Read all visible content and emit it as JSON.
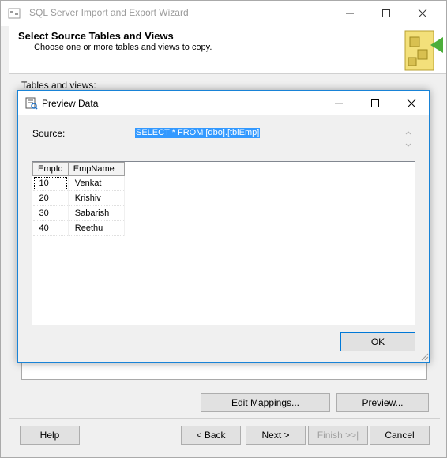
{
  "wizard": {
    "title": "SQL Server Import and Export Wizard",
    "header_title": "Select Source Tables and Views",
    "header_subtitle": "Choose one or more tables and views to copy.",
    "tables_label": "Tables and views:",
    "buttons": {
      "edit_mappings": "Edit Mappings...",
      "preview": "Preview...",
      "help": "Help",
      "back": "< Back",
      "next": "Next >",
      "finish": "Finish >>|",
      "cancel": "Cancel"
    }
  },
  "dialog": {
    "title": "Preview Data",
    "source_label": "Source:",
    "source_query": "SELECT * FROM [dbo].[tblEmp]",
    "columns": [
      "EmpId",
      "EmpName"
    ],
    "rows": [
      [
        "10",
        "Venkat"
      ],
      [
        "20",
        "Krishiv"
      ],
      [
        "30",
        "Sabarish"
      ],
      [
        "40",
        "Reethu"
      ]
    ],
    "ok_label": "OK"
  },
  "colors": {
    "accent": "#0078d7",
    "selection": "#3399ff",
    "window_bg": "#f0f0f0"
  }
}
